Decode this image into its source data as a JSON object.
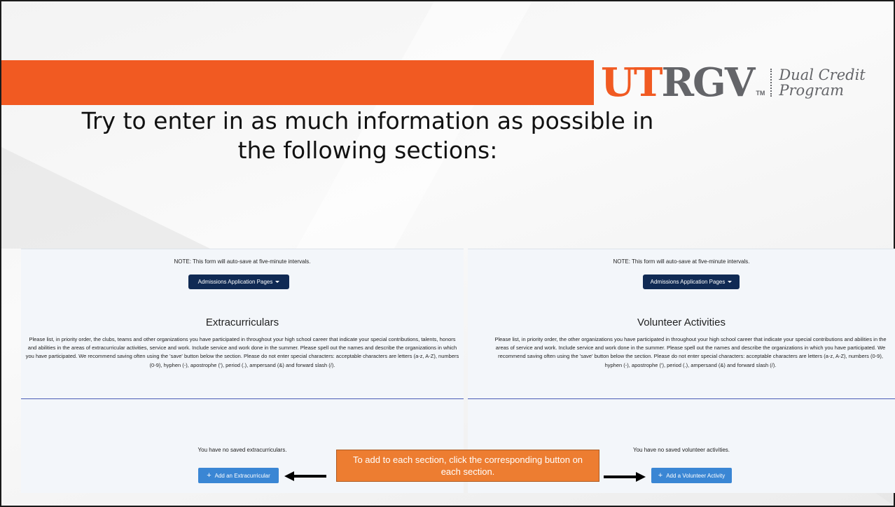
{
  "branding": {
    "logo_ut": "UT",
    "logo_rgv": "RGV",
    "logo_tm": "TM",
    "program_line1": "Dual Credit",
    "program_line2": "Program"
  },
  "slide": {
    "title": "Try to enter in as much information as possible in the following sections:"
  },
  "left_panel": {
    "note": "NOTE: This form will auto-save at five-minute intervals.",
    "pages_button": "Admissions Application Pages",
    "section_title": "Extracurriculars",
    "description": "Please list, in priority order, the clubs, teams and other organizations you have participated in throughout your high school career that indicate your special contributions, talents, honors and abilities in the areas of extracurricular activities, service and work. Include service and work done in the summer. Please spell out the names and describe the organizations in which you have participated. We recommend saving often using the 'save' button below the section. Please do not enter special characters: acceptable characters are letters (a-z, A-Z), numbers (0-9), hyphen (-), apostrophe ('), period (.), ampersand (&) and forward slash (/).",
    "empty_message": "You have no saved extracurriculars.",
    "add_button": "Add an Extracurricular"
  },
  "right_panel": {
    "note": "NOTE: This form will auto-save at five-minute intervals.",
    "pages_button": "Admissions Application Pages",
    "section_title": "Volunteer Activities",
    "description": "Please list, in priority order, the other organizations you have participated in throughout your high school career that indicate your special contributions and abilities in the areas of service and work. Include service and work done in the summer. Please spell out the names and describe the organizations in which you have participated. We recommend saving often using the 'save' button below the section. Please do not enter special characters: acceptable characters are letters (a-z, A-Z), numbers (0-9), hyphen (-), apostrophe ('), period (.), ampersand (&) and forward slash (/).",
    "empty_message": "You have no saved volunteer activities.",
    "add_button": "Add a Volunteer Activity"
  },
  "callout": {
    "text": "To add to each section, click the corresponding button on each section."
  },
  "colors": {
    "brand_orange": "#f15a22",
    "brand_gray": "#646569",
    "nav_button": "#102a54",
    "add_button": "#3a86d4",
    "callout": "#ed7d31"
  }
}
